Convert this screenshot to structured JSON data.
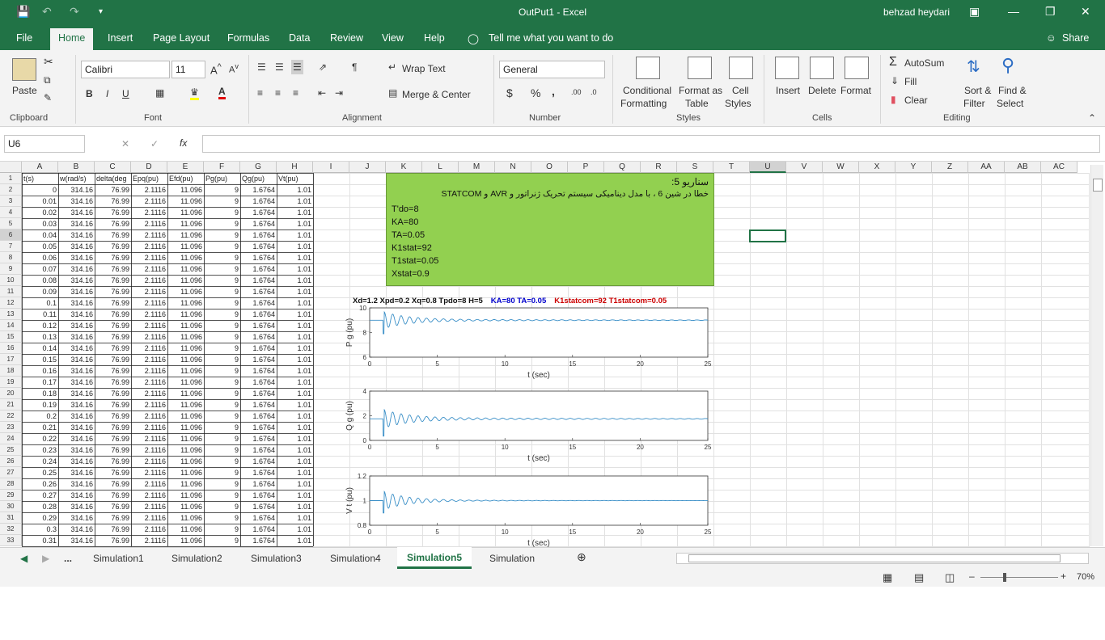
{
  "window": {
    "title": "OutPut1  -  Excel",
    "user": "behzad heydari"
  },
  "tabs": [
    "File",
    "Home",
    "Insert",
    "Page Layout",
    "Formulas",
    "Data",
    "Review",
    "View",
    "Help"
  ],
  "tell_me": "Tell me what you want to do",
  "share": "Share",
  "ribbon": {
    "clipboard": {
      "paste": "Paste",
      "label": "Clipboard"
    },
    "font": {
      "name": "Calibri",
      "size": "11",
      "bold": "B",
      "italic": "I",
      "underline": "U",
      "label": "Font"
    },
    "alignment": {
      "wrap": "Wrap Text",
      "merge": "Merge & Center",
      "label": "Alignment"
    },
    "number": {
      "format": "General",
      "currency": "$",
      "percent": "%",
      "comma": ",",
      "label": "Number"
    },
    "styles": {
      "cond": "Conditional",
      "cond2": "Formatting",
      "fmt": "Format as",
      "fmt2": "Table",
      "cell": "Cell",
      "cell2": "Styles",
      "label": "Styles"
    },
    "cells": {
      "insert": "Insert",
      "delete": "Delete",
      "format": "Format",
      "label": "Cells"
    },
    "editing": {
      "autosum": "AutoSum",
      "fill": "Fill",
      "clear": "Clear",
      "sort": "Sort &",
      "sort2": "Filter",
      "find": "Find &",
      "find2": "Select",
      "label": "Editing"
    }
  },
  "formula_bar": {
    "name_box": "U6",
    "fx": "fx",
    "formula": ""
  },
  "columns": [
    "A",
    "B",
    "C",
    "D",
    "E",
    "F",
    "G",
    "H",
    "I",
    "J",
    "K",
    "L",
    "M",
    "N",
    "O",
    "P",
    "Q",
    "R",
    "S",
    "T",
    "U",
    "V",
    "W",
    "X",
    "Y",
    "Z",
    "AA",
    "AB",
    "AC"
  ],
  "headers": [
    "t(s)",
    "w(rad/s)",
    "delta(deg",
    "Epq(pu)",
    "Efd(pu)",
    "Pg(pu)",
    "Qg(pu)",
    "Vt(pu)"
  ],
  "t_values": [
    "0",
    "0.01",
    "0.02",
    "0.03",
    "0.04",
    "0.05",
    "0.06",
    "0.07",
    "0.08",
    "0.09",
    "0.1",
    "0.11",
    "0.12",
    "0.13",
    "0.14",
    "0.15",
    "0.16",
    "0.17",
    "0.18",
    "0.19",
    "0.2",
    "0.21",
    "0.22",
    "0.23",
    "0.24",
    "0.25",
    "0.26",
    "0.27",
    "0.28",
    "0.29",
    "0.3",
    "0.31"
  ],
  "row_const": [
    "314.16",
    "76.99",
    "2.1116",
    "11.096",
    "9",
    "1.6764",
    "1.01"
  ],
  "note": {
    "title": "سناریو 5:",
    "line": "خطا در شین 6 ، با مدل دینامیکی سیستم تحریک ژنراتور و AVR و STATCOM",
    "params": [
      "T'do=8",
      "KA=80",
      "TA=0.05",
      "K1stat=92",
      "T1stat=0.05",
      "Xstat=0.9"
    ]
  },
  "chart_header": {
    "black": "Xd=1.2    Xpd=0.2    Xq=0.8    Tpdo=8    H=5",
    "blue": "KA=80  TA=0.05",
    "red": "K1statcom=92   T1statcom=0.05",
    "blue_color": "#0000cc",
    "red_color": "#cc0000"
  },
  "chart_data": [
    {
      "type": "line",
      "xlabel": "t (sec)",
      "ylabel": "P g (pu)",
      "xlim": [
        0,
        25
      ],
      "ylim": [
        6,
        10
      ],
      "yticks": [
        "10",
        "8",
        "6"
      ],
      "xticks": [
        "0",
        "5",
        "10",
        "15",
        "20",
        "25"
      ],
      "steady": 9,
      "fault_time": 1,
      "dip": 7.9,
      "overshoot": 9.6,
      "ringing_amp": 0.45
    },
    {
      "type": "line",
      "xlabel": "t (sec)",
      "ylabel": "Q g (pu)",
      "xlim": [
        0,
        25
      ],
      "ylim": [
        0,
        4
      ],
      "yticks": [
        "4",
        "2",
        "0"
      ],
      "xticks": [
        "0",
        "5",
        "10",
        "15",
        "20",
        "25"
      ],
      "steady": 1.75,
      "fault_time": 1,
      "dip": 0.35,
      "overshoot": 2.4,
      "ringing_amp": 0.6
    },
    {
      "type": "line",
      "xlabel": "t (sec)",
      "ylabel": "V t (pu)",
      "xlim": [
        0,
        25
      ],
      "ylim": [
        0.8,
        1.2
      ],
      "yticks": [
        "1.2",
        "1",
        "0.8"
      ],
      "xticks": [
        "0",
        "5",
        "10",
        "15",
        "20",
        "25"
      ],
      "steady": 1.0,
      "fault_time": 1,
      "dip": 0.9,
      "overshoot": 1.07,
      "ringing_amp": 0.02
    }
  ],
  "sheets": [
    "...",
    "Simulation1",
    "Simulation2",
    "Simulation3",
    "Simulation4",
    "Simulation5",
    "Simulation"
  ],
  "active_sheet": "Simulation5",
  "zoom": "70%"
}
